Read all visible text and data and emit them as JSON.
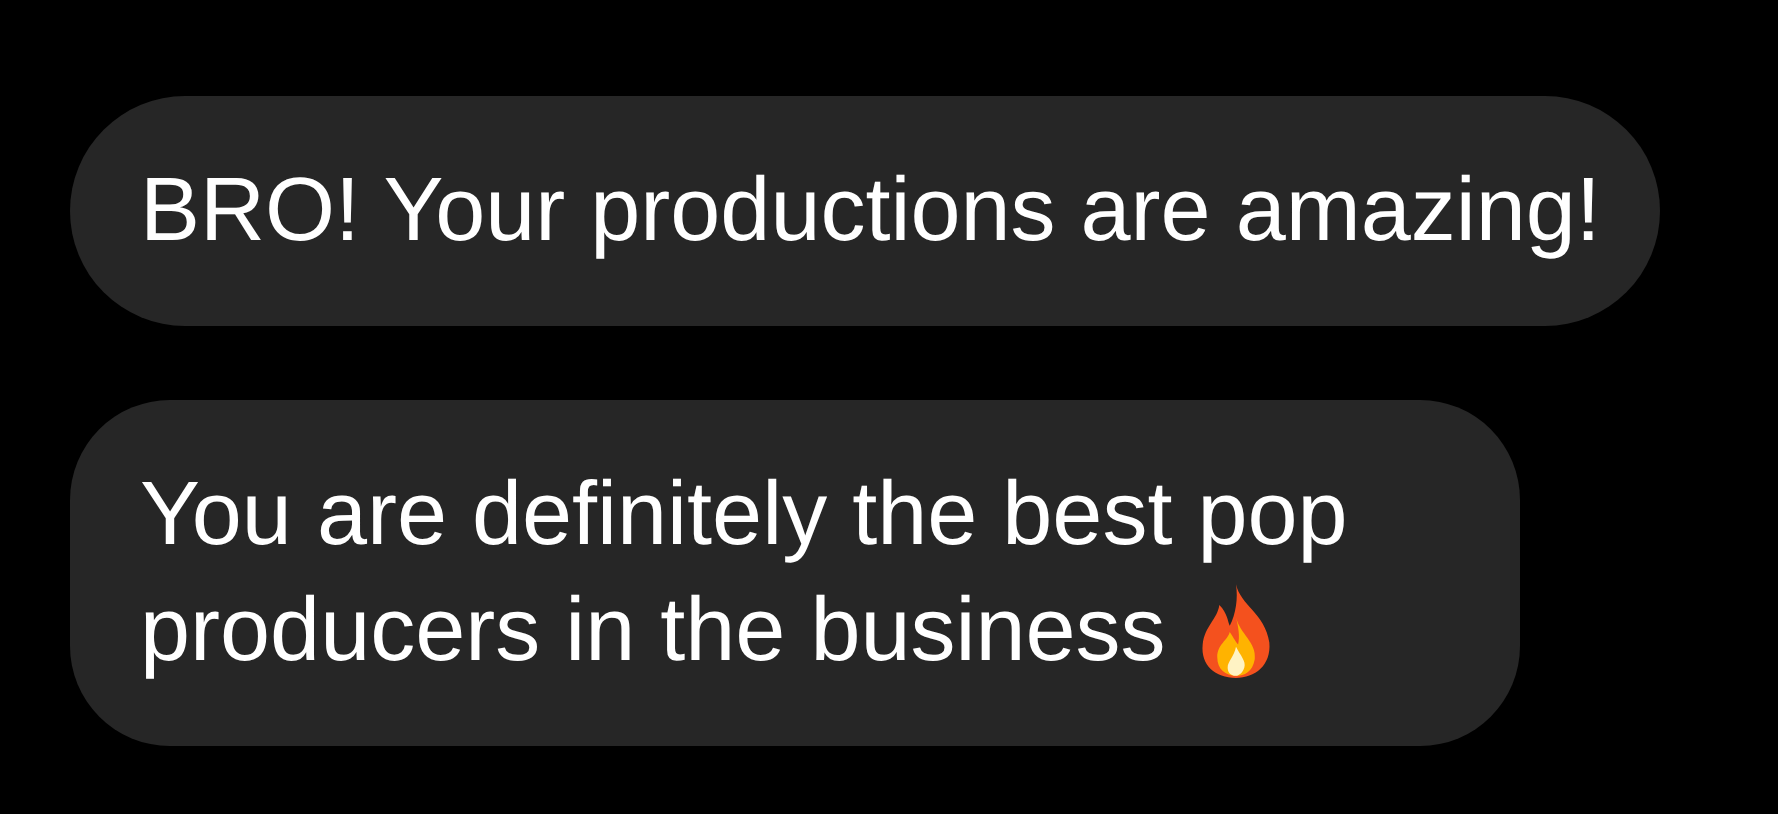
{
  "messages": [
    {
      "kind": "plain",
      "text": "BRO! Your productions are amazing!"
    },
    {
      "kind": "with-fire",
      "text": "You are definitely the best pop producers in the business"
    }
  ]
}
